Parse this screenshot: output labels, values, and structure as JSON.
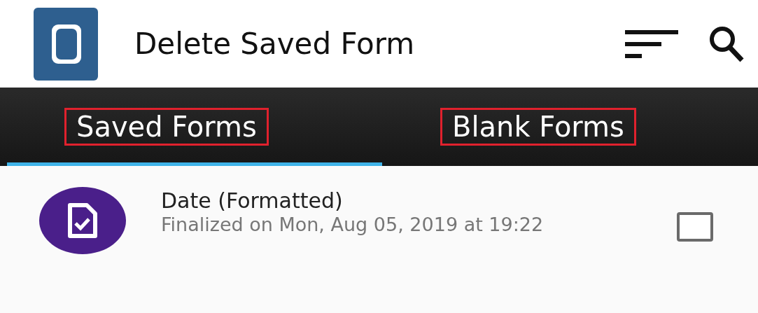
{
  "app_bar": {
    "title": "Delete Saved Form"
  },
  "tabs": [
    {
      "label": "Saved Forms",
      "selected": true
    },
    {
      "label": "Blank Forms",
      "selected": false
    }
  ],
  "forms": [
    {
      "title": "Date (Formatted)",
      "subtitle": "Finalized on Mon, Aug 05, 2019 at 19:22",
      "checked": false
    }
  ]
}
